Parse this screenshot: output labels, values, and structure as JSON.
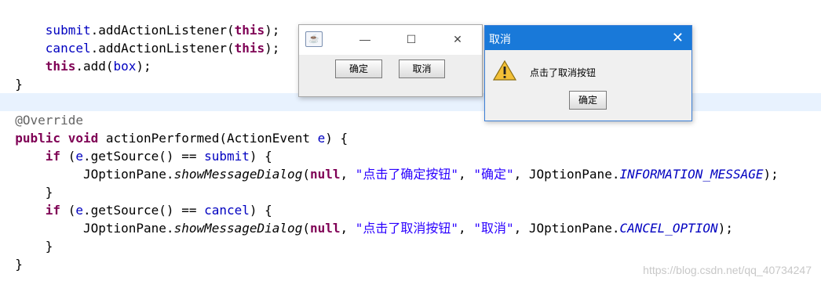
{
  "code": {
    "line1": {
      "obj": "submit",
      "call": ".addActionListener(",
      "kw": "this",
      "end": ");"
    },
    "line2": {
      "obj": "cancel",
      "call": ".addActionListener(",
      "kw": "this",
      "end": ");"
    },
    "line3": {
      "kw": "this",
      "call": ".add(",
      "arg": "box",
      "end": ");"
    },
    "line4": "}",
    "line6": "@Override",
    "line7": {
      "kw1": "public",
      "kw2": "void",
      "sig": " actionPerformed(ActionEvent ",
      "param": "e",
      "end": ") {"
    },
    "line8": {
      "kw": "if",
      "a": " (",
      "param": "e",
      "b": ".getSource() == ",
      "field": "submit",
      "c": ") {"
    },
    "line9": {
      "cls": "JOptionPane.",
      "method": "showMessageDialog",
      "open": "(",
      "null": "null",
      "s1": "\"点击了确定按钮\"",
      "s2": "\"确定\"",
      "cls2": "JOptionPane.",
      "const": "INFORMATION_MESSAGE",
      "end": ");"
    },
    "line10": "}",
    "line11": {
      "kw": "if",
      "a": " (",
      "param": "e",
      "b": ".getSource() == ",
      "field": "cancel",
      "c": ") {"
    },
    "line12": {
      "cls": "JOptionPane.",
      "method": "showMessageDialog",
      "open": "(",
      "null": "null",
      "s1": "\"点击了取消按钮\"",
      "s2": "\"取消\"",
      "cls2": "JOptionPane.",
      "const": "CANCEL_OPTION",
      "end": ");"
    },
    "line13": "}",
    "line14": "}"
  },
  "window1": {
    "icon": "java-cup-icon",
    "minimize": "—",
    "maximize": "☐",
    "close": "✕",
    "confirm_label": "确定",
    "cancel_label": "取消"
  },
  "dialog": {
    "title": "取消",
    "close": "✕",
    "icon": "warning-icon",
    "message": "点击了取消按钮",
    "ok_label": "确定"
  },
  "watermark": "https://blog.csdn.net/qq_40734247"
}
